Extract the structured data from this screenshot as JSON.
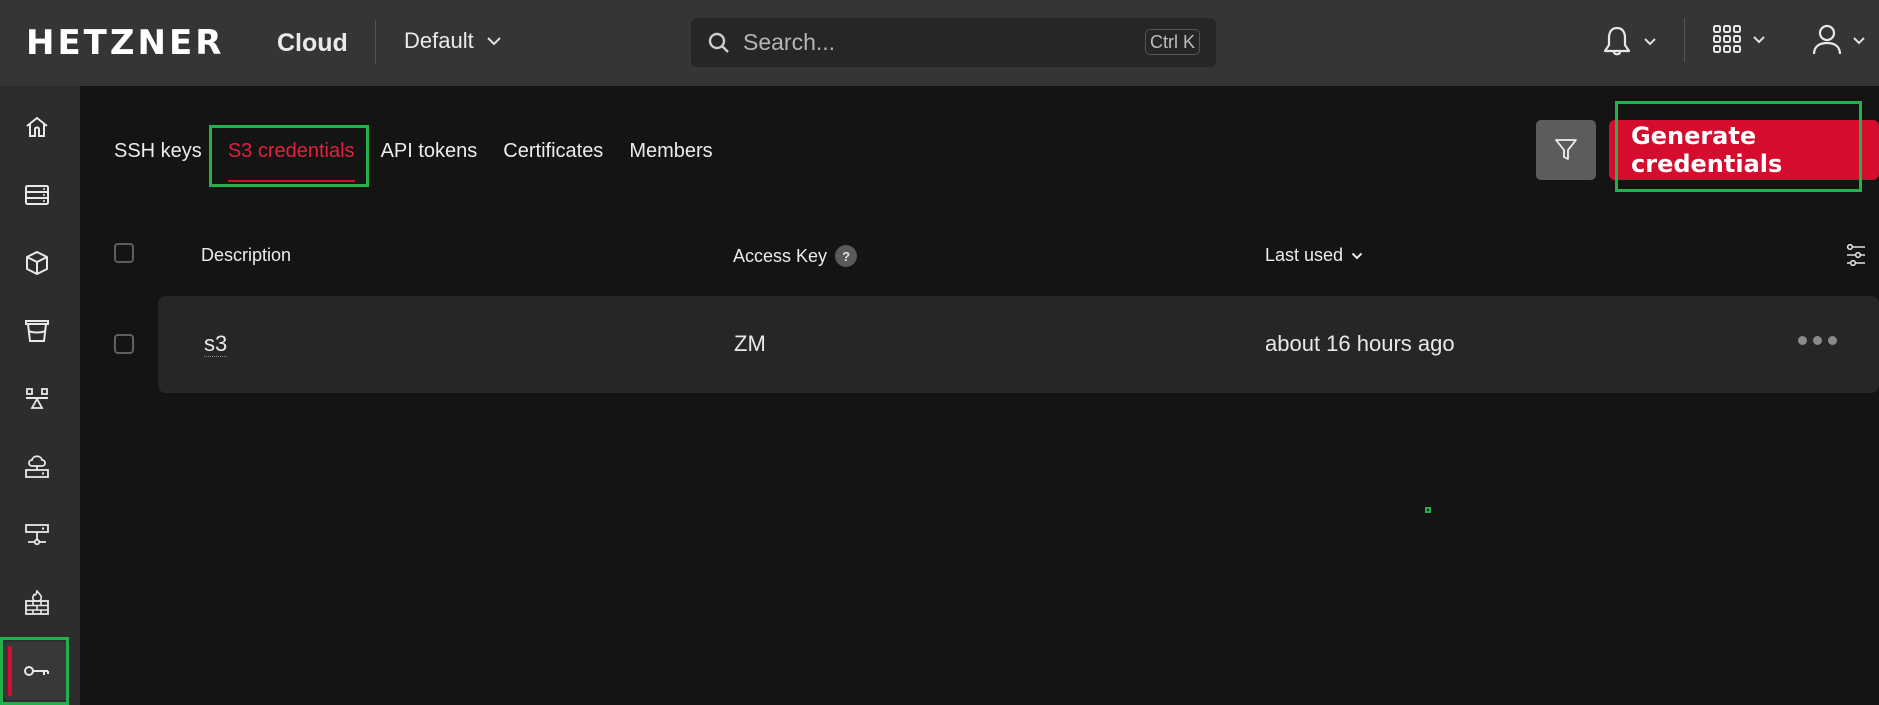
{
  "header": {
    "brand": "HETZNER",
    "product": "Cloud",
    "project": "Default",
    "search": {
      "placeholder": "Search...",
      "value": "",
      "shortcut": "Ctrl K"
    },
    "icons": [
      "bell-icon",
      "apps-grid-icon",
      "user-icon"
    ]
  },
  "sidebar": {
    "items": [
      {
        "name": "home",
        "icon": "home-icon",
        "active": false
      },
      {
        "name": "servers",
        "icon": "server-rack-icon",
        "active": false
      },
      {
        "name": "volumes",
        "icon": "cube-icon",
        "active": false
      },
      {
        "name": "object-storage",
        "icon": "bucket-icon",
        "active": false
      },
      {
        "name": "load-balancers",
        "icon": "load-balancer-icon",
        "active": false
      },
      {
        "name": "primary-ips",
        "icon": "cloud-server-icon",
        "active": false
      },
      {
        "name": "networks",
        "icon": "network-icon",
        "active": false
      },
      {
        "name": "firewalls",
        "icon": "firewall-icon",
        "active": false
      },
      {
        "name": "security",
        "icon": "key-icon",
        "active": true
      }
    ]
  },
  "tabs": [
    {
      "label": "SSH keys",
      "active": false
    },
    {
      "label": "S3 credentials",
      "active": true
    },
    {
      "label": "API tokens",
      "active": false
    },
    {
      "label": "Certificates",
      "active": false
    },
    {
      "label": "Members",
      "active": false
    }
  ],
  "toolbar": {
    "generate_label": "Generate credentials",
    "filter_icon": "filter-icon"
  },
  "table": {
    "columns": [
      "Description",
      "Access Key",
      "Last used"
    ],
    "sort_column": "Last used",
    "rows": [
      {
        "description": "s3",
        "access_key": "ZM",
        "last_used": "about 16 hours ago"
      }
    ]
  },
  "colors": {
    "accent": "#d50c2d",
    "header_bg": "#353535",
    "sidebar_bg": "#2d2d2d",
    "page_bg": "#141414",
    "row_bg": "#262626",
    "highlight": "#22b14c"
  }
}
